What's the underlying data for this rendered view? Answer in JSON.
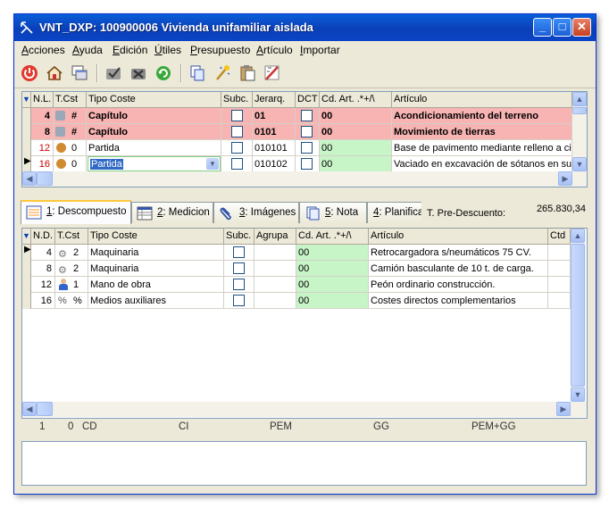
{
  "window": {
    "title": "VNT_DXP: 100900006 Vivienda unifamiliar aislada",
    "min_glyph": "_",
    "max_glyph": "□",
    "close_glyph": "✕"
  },
  "menu": [
    {
      "label": "Acciones",
      "key": "A",
      "rest": "cciones"
    },
    {
      "label": "Ayuda",
      "key": "A",
      "rest": "yuda"
    },
    {
      "label": "Edición",
      "key": "E",
      "rest": "dición"
    },
    {
      "label": "Útiles",
      "key": "Ú",
      "rest": "tiles"
    },
    {
      "label": "Presupuesto",
      "key": "P",
      "rest": "resupuesto"
    },
    {
      "label": "Artículo",
      "key": "A",
      "rest": "rtículo"
    },
    {
      "label": "Importar",
      "key": "I",
      "rest": "mportar"
    }
  ],
  "toolbar_icons": [
    "power-icon",
    "home-icon",
    "windows-icon",
    "approve-icon",
    "merge-icon",
    "refresh-icon",
    "copy-icon",
    "wand-icon",
    "paste-icon",
    "pencil-ruler-icon"
  ],
  "top_grid": {
    "headers": [
      "N.L.",
      "T.Cst",
      "Tipo Coste",
      "Subc.",
      "Jerarq.",
      "DCT",
      "Cd. Art. .*+/\\",
      "Artículo"
    ],
    "rows": [
      {
        "nl": "4",
        "icon": "#",
        "tipo": "Capítulo",
        "jer": "01",
        "cd": "00",
        "art": "Acondicionamiento del terreno"
      },
      {
        "nl": "8",
        "icon": "#",
        "tipo": "Capítulo",
        "jer": "0101",
        "cd": "00",
        "art": "Movimiento de tierras"
      },
      {
        "nl": "12",
        "icon": "0",
        "tipo": "Partida",
        "jer": "010101",
        "cd": "00",
        "art": "Base de pavimento mediante relleno a cielo"
      },
      {
        "nl": "16",
        "icon": "0",
        "tipo": "Partida",
        "jer": "010102",
        "cd": "00",
        "art": "Vaciado en excavación de sótanos en suelo"
      }
    ]
  },
  "tabs": [
    {
      "num": "1",
      "label": ": Descompuesto"
    },
    {
      "num": "2",
      "label": ": Medicion"
    },
    {
      "num": "3",
      "label": ": Imágenes"
    },
    {
      "num": "5",
      "label": ": Nota"
    },
    {
      "num": "4",
      "label": ": Planifica"
    }
  ],
  "pre_descuento": {
    "label": "T. Pre-Descuento:",
    "value": "265.830,34"
  },
  "bottom_grid": {
    "headers": [
      "N.D.",
      "T.Cst",
      "Tipo Coste",
      "Subc.",
      "Agrupa",
      "Cd. Art. .*+/\\",
      "Artículo",
      "Ctd"
    ],
    "rows": [
      {
        "nd": "4",
        "icon": "2",
        "tipo": "Maquinaria",
        "cd": "00",
        "art": "Retrocargadora s/neumáticos 75 CV."
      },
      {
        "nd": "8",
        "icon": "2",
        "tipo": "Maquinaria",
        "cd": "00",
        "art": "Camión basculante de 10 t. de carga."
      },
      {
        "nd": "12",
        "icon": "1",
        "tipo": "Mano de obra",
        "cd": "00",
        "art": "Peón ordinario construcción."
      },
      {
        "nd": "16",
        "icon": "%",
        "tipo": "Medios auxiliares",
        "cd": "00",
        "art": "Costes directos complementarios"
      }
    ]
  },
  "footer": {
    "n1": "1",
    "n2": "0",
    "cd": "CD",
    "ci": "CI",
    "pem": "PEM",
    "gg": "GG",
    "pemgg": "PEM+GG"
  },
  "colors": {
    "chapter_row": "#f8b3b3",
    "code_cell": "#c8f5c8"
  }
}
